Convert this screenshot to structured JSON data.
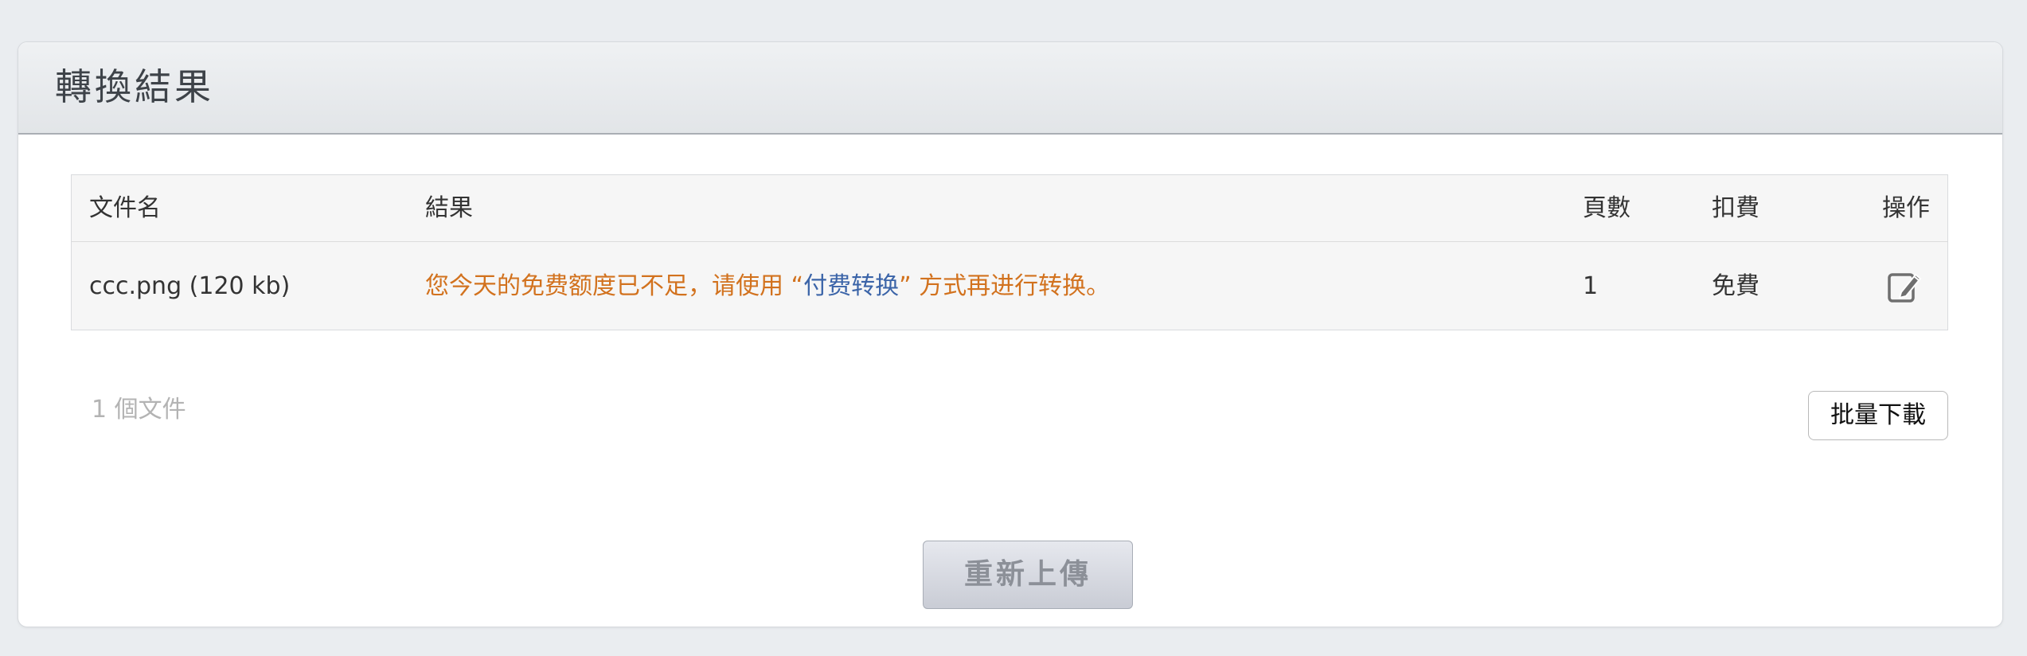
{
  "panel": {
    "title": "轉換結果"
  },
  "table": {
    "columns": {
      "filename": "文件名",
      "result": "結果",
      "pages": "頁數",
      "fee": "扣費",
      "actions": "操作"
    },
    "rows": [
      {
        "filename": "ccc.png (120 kb)",
        "result_prefix": "您今天的免费额度已不足，请使用 “",
        "result_link": "付费转换",
        "result_suffix": "” 方式再进行转换。",
        "pages": "1",
        "fee": "免費",
        "action_icon": "edit-icon"
      }
    ]
  },
  "footer": {
    "file_count": "1 個文件",
    "batch_download_label": "批量下載",
    "reupload_label": "重新上傳"
  },
  "colors": {
    "warning_text": "#d2721e",
    "link_text": "#3b64a8",
    "background": "#eaedf0"
  }
}
